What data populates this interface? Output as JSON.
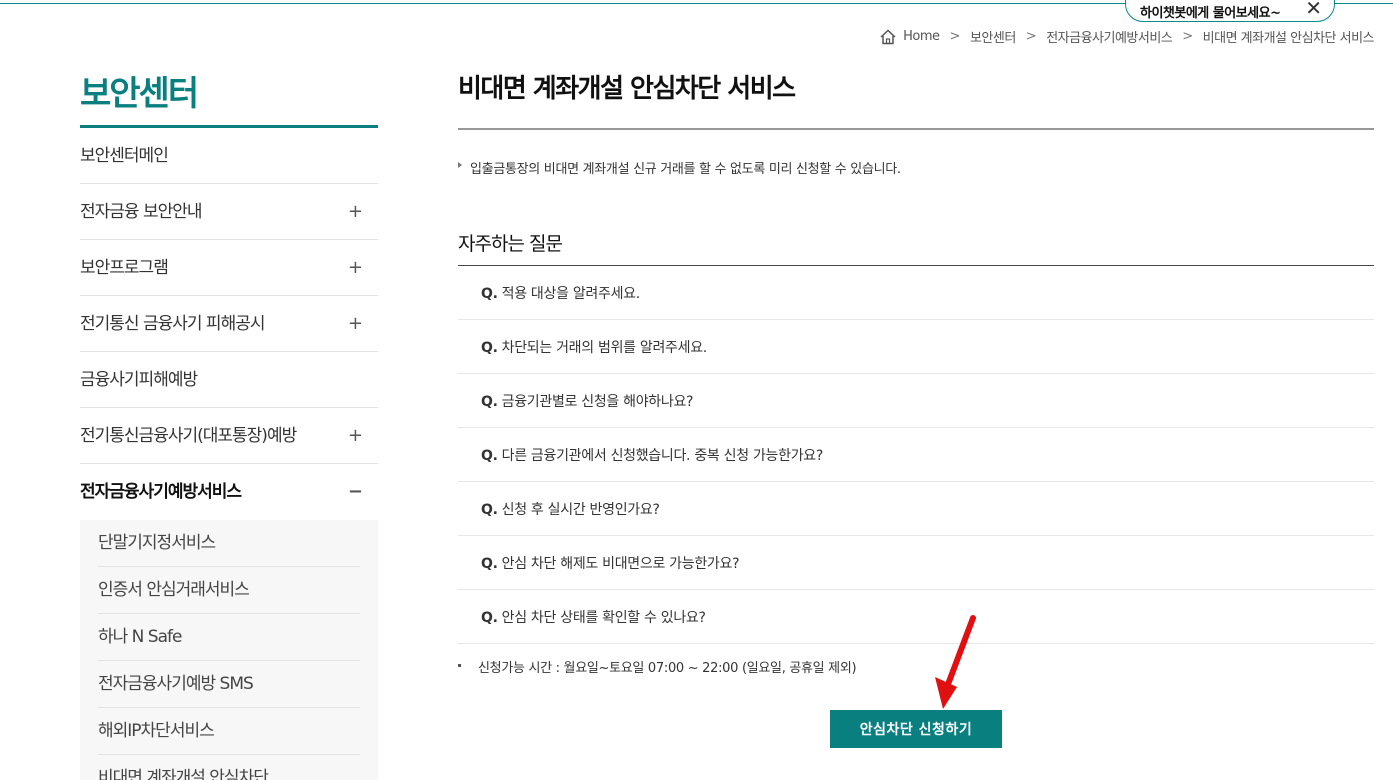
{
  "chatbot": {
    "label": "하이챗봇에게 물어보세요~",
    "close": "✕"
  },
  "breadcrumb": {
    "items": [
      "Home",
      "보안센터",
      "전자금융사기예방서비스",
      "비대면 계좌개설 안심차단 서비스"
    ],
    "separator": ">"
  },
  "sidebar": {
    "title": "보안센터",
    "items": [
      {
        "label": "보안센터메인",
        "toggle": ""
      },
      {
        "label": "전자금융 보안안내",
        "toggle": "+"
      },
      {
        "label": "보안프로그램",
        "toggle": "+"
      },
      {
        "label": "전기통신 금융사기 피해공시",
        "toggle": "+"
      },
      {
        "label": "금융사기피해예방",
        "toggle": ""
      },
      {
        "label": "전기통신금융사기(대포통장)예방",
        "toggle": "+"
      },
      {
        "label": "전자금융사기예방서비스",
        "toggle": "−"
      }
    ],
    "subitems": [
      "단말기지정서비스",
      "인증서 안심거래서비스",
      "하나 N Safe",
      "전자금융사기예방 SMS",
      "해외IP차단서비스",
      "비대면 계좌개설 안심차단"
    ]
  },
  "main": {
    "title": "비대면 계좌개설 안심차단 서비스",
    "description": "입출금통장의 비대면 계좌개설 신규 거래를 할 수 없도록 미리 신청할 수 있습니다.",
    "faq_title": "자주하는 질문",
    "faq_prefix": "Q.",
    "faq": [
      "적용 대상을 알려주세요.",
      "차단되는 거래의 범위를 알려주세요.",
      "금융기관별로 신청을 해야하나요?",
      "다른 금융기관에서 신청했습니다. 중복 신청 가능한가요?",
      "신청 후 실시간 반영인가요?",
      "안심 차단 해제도 비대면으로 가능한가요?",
      "안심 차단 상태를 확인할 수 있나요?"
    ],
    "hours": "신청가능 시간 : 월요일~토요일 07:00 ~ 22:00 (일요일, 공휴일 제외)",
    "apply_button": "안심차단 신청하기"
  },
  "colors": {
    "accent": "#0a7f80",
    "arrow": "#e01010"
  }
}
